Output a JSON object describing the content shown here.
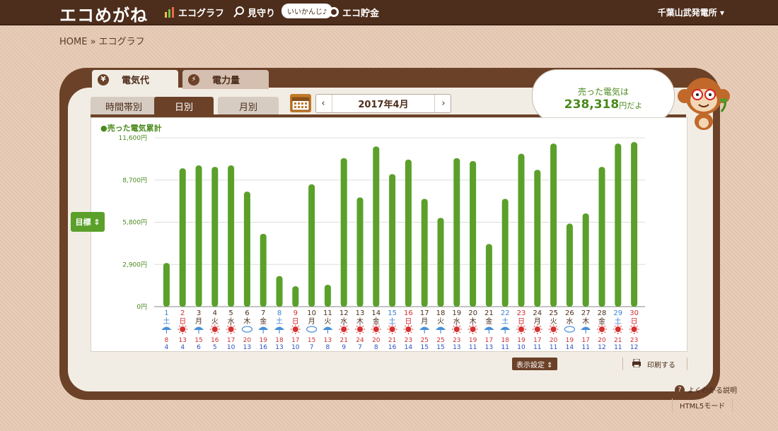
{
  "app": {
    "logo": "エコめがね",
    "nav": [
      "エコグラフ",
      "見守り",
      "エコ貯金"
    ],
    "bubble": "いいかんじ♪",
    "plant": "千葉山武発電所 ▾"
  },
  "breadcrumb": "HOME » エコグラフ",
  "tabs": {
    "cost": "電気代",
    "power": "電力量"
  },
  "subtabs": [
    "時間帯別",
    "日別",
    "月別"
  ],
  "date_label": "2017年4月",
  "prev_arrow": "‹",
  "next_arrow": "›",
  "sold": {
    "line1": "売った電気は",
    "amount": "238,318",
    "suffix": "円だよ"
  },
  "legend": "●売った電気累計",
  "target_label": "目標 ⇕",
  "display_settings": "表示設定 ⇕",
  "print_label": "印刷する",
  "help_label": "よくわかる説明",
  "html5_label": "HTML5モード",
  "colors": {
    "bar": "#5aa02a",
    "brown": "#6b4128",
    "sat": "#3a7fd5",
    "sun": "#d03030"
  },
  "chart_data": {
    "type": "bar",
    "y_ticks": [
      "0円",
      "2,900円",
      "5,800円",
      "8,700円",
      "11,600円"
    ],
    "ylim": [
      0,
      11600
    ],
    "categories": [
      "1",
      "2",
      "3",
      "4",
      "5",
      "6",
      "7",
      "8",
      "9",
      "10",
      "11",
      "12",
      "13",
      "14",
      "15",
      "16",
      "17",
      "18",
      "19",
      "20",
      "21",
      "22",
      "23",
      "24",
      "25",
      "26",
      "27",
      "28",
      "29",
      "30"
    ],
    "weekdays": [
      "土",
      "日",
      "月",
      "火",
      "水",
      "木",
      "金",
      "土",
      "日",
      "月",
      "火",
      "水",
      "木",
      "金",
      "土",
      "日",
      "月",
      "火",
      "水",
      "木",
      "金",
      "土",
      "日",
      "月",
      "火",
      "水",
      "木",
      "金",
      "土",
      "日"
    ],
    "values": [
      3000,
      9500,
      9700,
      9600,
      9700,
      7900,
      5000,
      2100,
      1400,
      8400,
      1500,
      10200,
      7500,
      11000,
      9100,
      10100,
      7400,
      6100,
      10200,
      10000,
      4300,
      7400,
      10500,
      9400,
      11200,
      5700,
      6400,
      9600,
      11200,
      11300
    ],
    "weather": [
      "rain",
      "sun",
      "rain",
      "sun",
      "sun",
      "cloud",
      "rain",
      "rain",
      "sun",
      "cloud",
      "rain",
      "sun",
      "sun",
      "sun",
      "sun",
      "sun",
      "rain",
      "rain",
      "sun",
      "sun",
      "rain",
      "rain",
      "sun",
      "sun",
      "sun",
      "cloud",
      "rain",
      "sun",
      "sun",
      "sun"
    ],
    "high_temps": [
      "8",
      "13",
      "15",
      "16",
      "17",
      "20",
      "19",
      "18",
      "17",
      "15",
      "13",
      "21",
      "24",
      "20",
      "21",
      "23",
      "25",
      "25",
      "23",
      "19",
      "17",
      "18",
      "19",
      "17",
      "20",
      "19",
      "17",
      "20",
      "21",
      "23"
    ],
    "low_temps": [
      "4",
      "4",
      "6",
      "5",
      "10",
      "13",
      "16",
      "13",
      "10",
      "7",
      "8",
      "9",
      "7",
      "8",
      "16",
      "14",
      "15",
      "15",
      "13",
      "11",
      "13",
      "11",
      "10",
      "11",
      "11",
      "14",
      "11",
      "12",
      "11",
      "12"
    ]
  }
}
